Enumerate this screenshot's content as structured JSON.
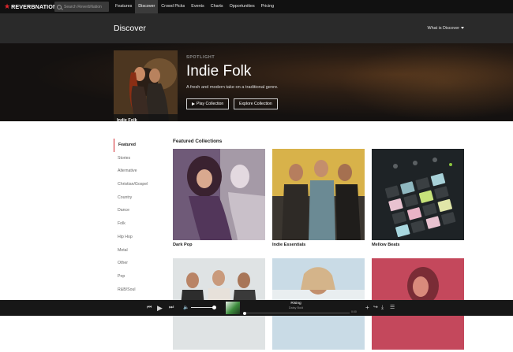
{
  "brand": {
    "name": "REVERBNATION"
  },
  "search": {
    "placeholder": "Search ReverbNation"
  },
  "nav": {
    "items": [
      "Features",
      "Discover",
      "Crowd Picks",
      "Events",
      "Charts",
      "Opportunities",
      "Pricing"
    ],
    "active": "Discover"
  },
  "header": {
    "title": "Discover",
    "menu_label": "What is Discover"
  },
  "spotlight": {
    "label": "SPOTLIGHT",
    "title": "Indie Folk",
    "description": "A fresh and modern take on a traditional genre.",
    "cover_caption": "Indie Folk",
    "play_button": "Play Collection",
    "explore_button": "Explore Collection"
  },
  "sidebar": {
    "active": "Featured",
    "items": [
      "Featured",
      "Stories",
      "Alternative",
      "Christian/Gospel",
      "Country",
      "Dance",
      "Folk",
      "Hip Hop",
      "Metal",
      "Other",
      "Pop",
      "R&B/Soul"
    ]
  },
  "featured": {
    "title": "Featured Collections",
    "collections": [
      "Dark Pop",
      "Indie Essentials",
      "Mellow Beats",
      "",
      "",
      ""
    ]
  },
  "player": {
    "song": "Rising",
    "artist": "Daisy Bold",
    "time": "0:00",
    "volume": 0.95,
    "progress": 0.0
  },
  "colors": {
    "accent": "#d3262c",
    "nav_bg": "#111111",
    "header_bg": "#2a2a2a",
    "player_bg": "#171717"
  }
}
